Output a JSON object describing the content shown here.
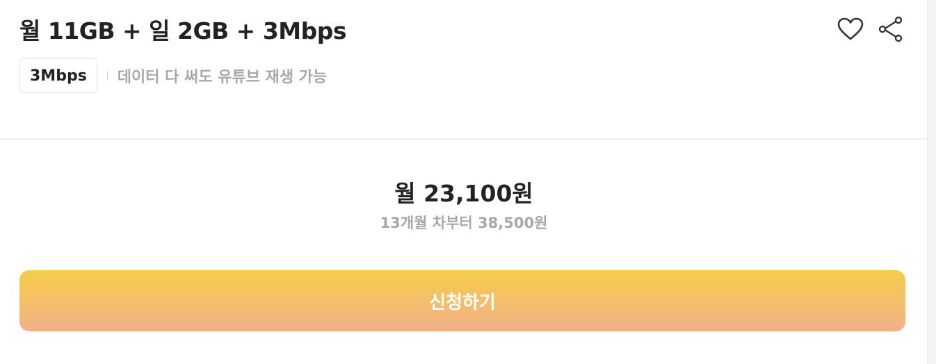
{
  "plan": {
    "title": "월 11GB + 일 2GB + 3Mbps",
    "speed_badge": "3Mbps",
    "speed_description": "데이터 다 써도 유튜브 재생 가능"
  },
  "actions": {
    "favorite_icon": "heart-icon",
    "share_icon": "share-icon"
  },
  "pricing": {
    "monthly_price": "월 23,100원",
    "after_promo_note": "13개월 차부터 38,500원"
  },
  "cta": {
    "apply_label": "신청하기",
    "gradient_top": "#f5cd4a",
    "gradient_bottom": "#f2b08a"
  }
}
